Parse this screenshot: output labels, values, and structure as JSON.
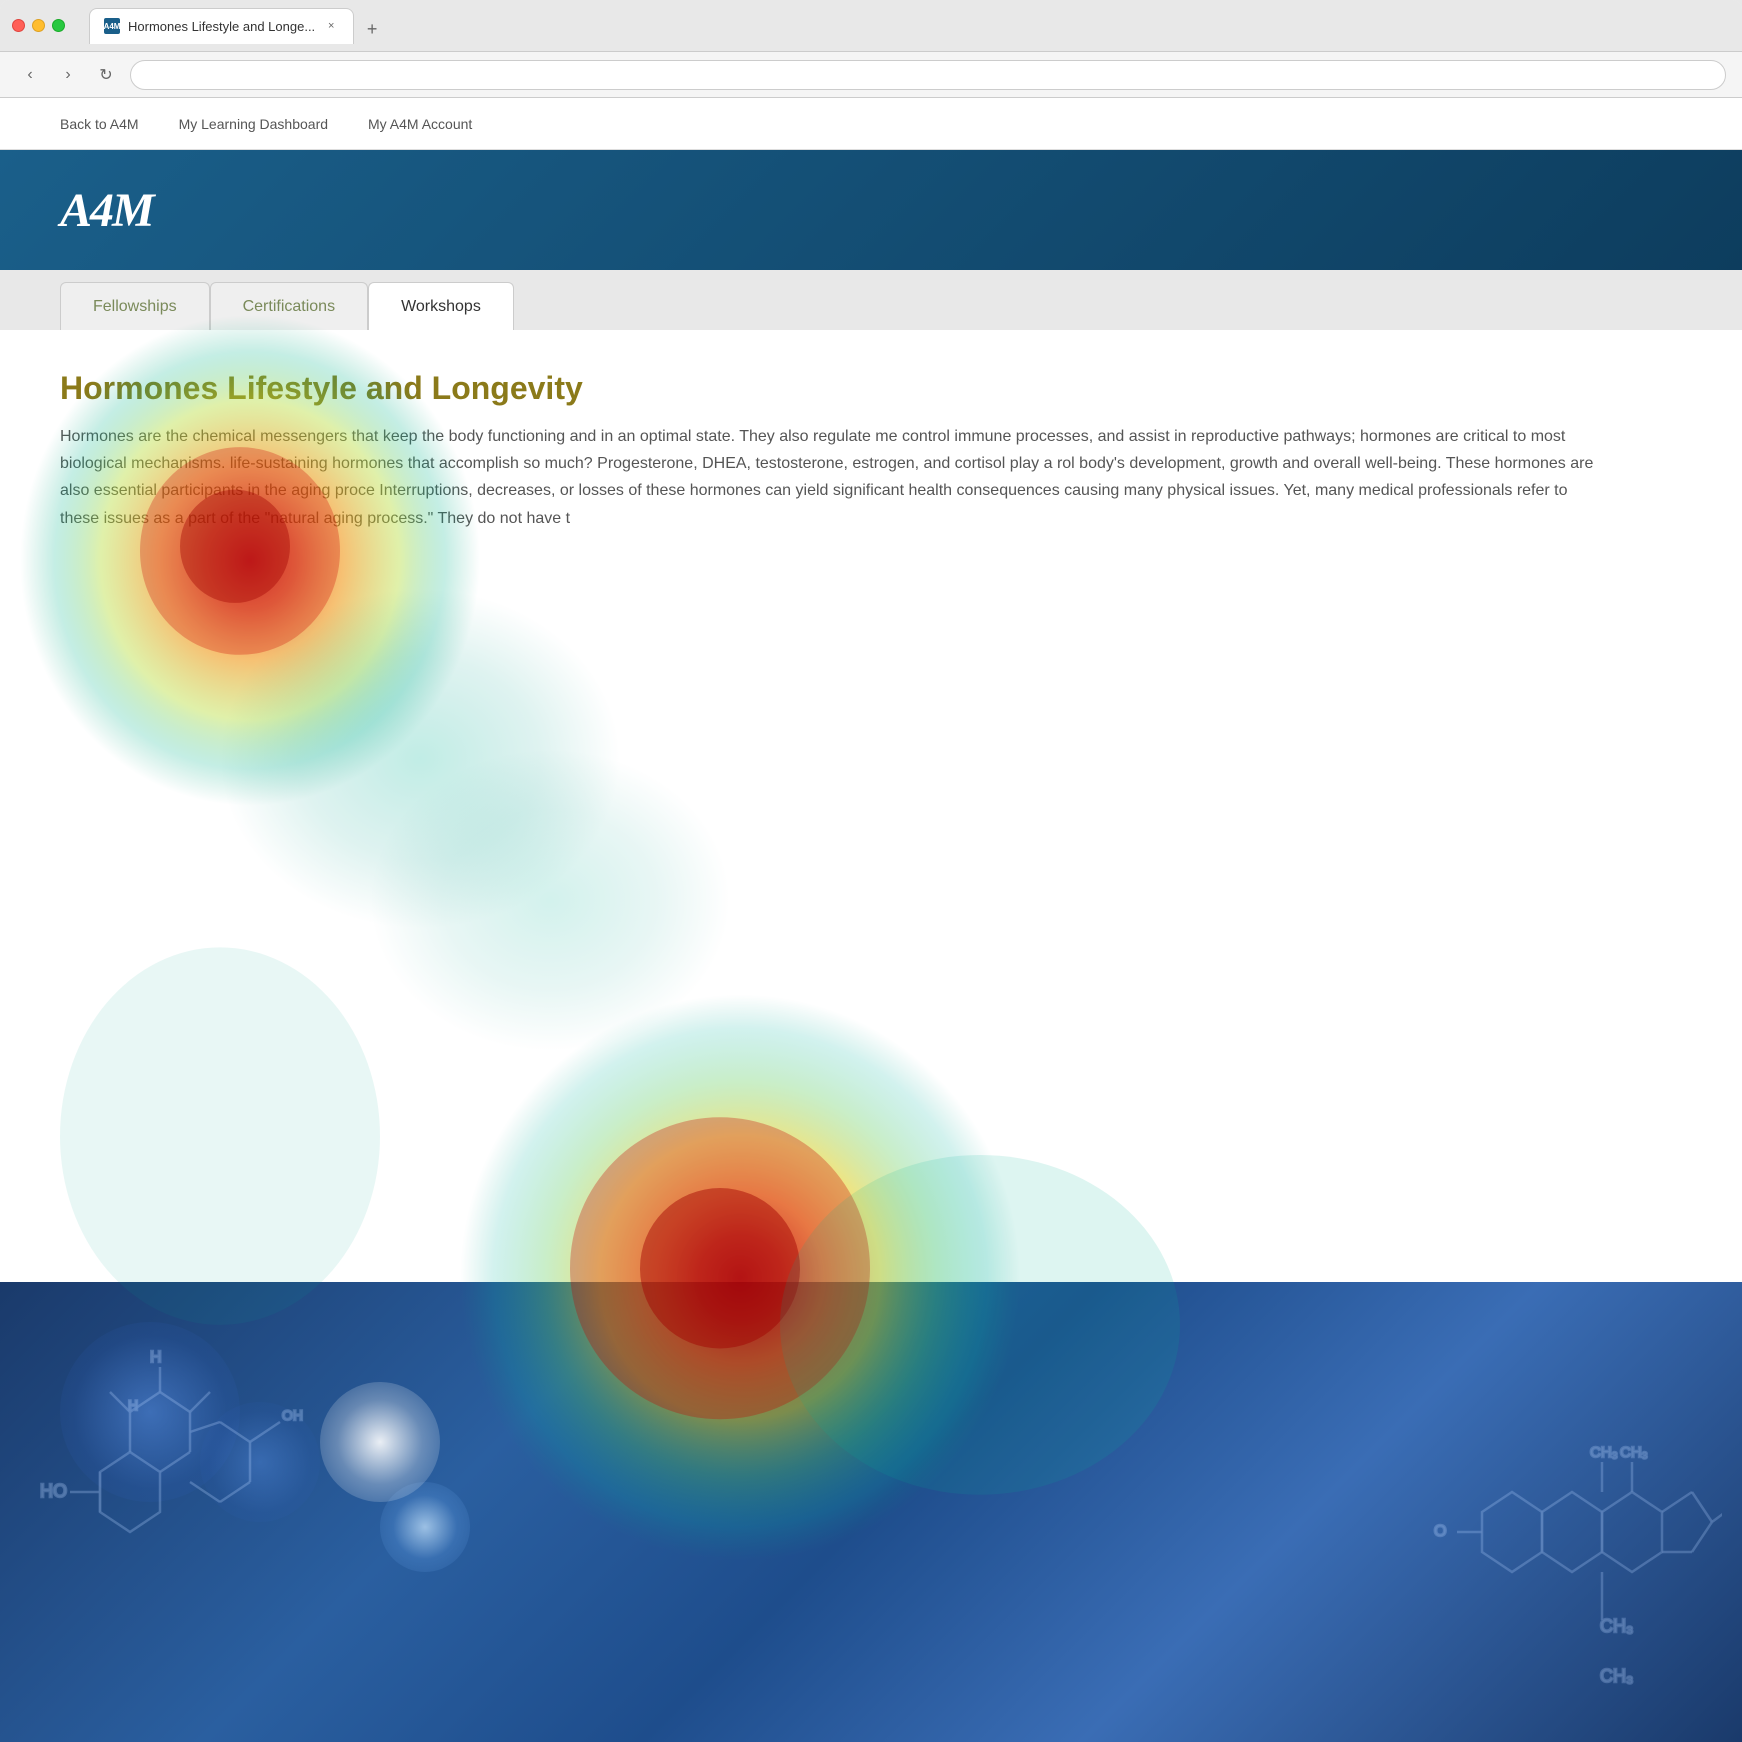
{
  "browser": {
    "tab_title": "Hormones Lifestyle and Longe...",
    "favicon_text": "A4M",
    "close_icon": "×",
    "new_tab_icon": "+",
    "back_icon": "‹",
    "forward_icon": "›",
    "refresh_icon": "↻",
    "address_bar_value": ""
  },
  "site_nav": {
    "links": [
      {
        "label": "Back to A4M",
        "id": "back-to-a4m"
      },
      {
        "label": "My Learning Dashboard",
        "id": "my-learning-dashboard"
      },
      {
        "label": "My A4M Account",
        "id": "my-a4m-account"
      }
    ]
  },
  "header": {
    "logo_text": "A4M"
  },
  "tabs": [
    {
      "label": "Fellowships",
      "active": false
    },
    {
      "label": "Certifications",
      "active": false
    },
    {
      "label": "Workshops",
      "active": true
    }
  ],
  "article": {
    "title": "Hormones Lifestyle and Longevity",
    "body": "Hormones are the chemical messengers that keep the body functioning and in an optimal state. They also regulate me control immune processes, and assist in reproductive pathways; hormones are critical to most biological mechanisms. life-sustaining hormones that accomplish so much? Progesterone, DHEA, testosterone, estrogen, and cortisol play a rol body's development, growth and overall well-being. These hormones are also essential participants in the aging proce Interruptions, decreases, or losses of these hormones can yield significant health consequences causing many physical issues. Yet, many medical professionals refer to these issues as a part of the \"natural aging process.\" They do not have t"
  }
}
